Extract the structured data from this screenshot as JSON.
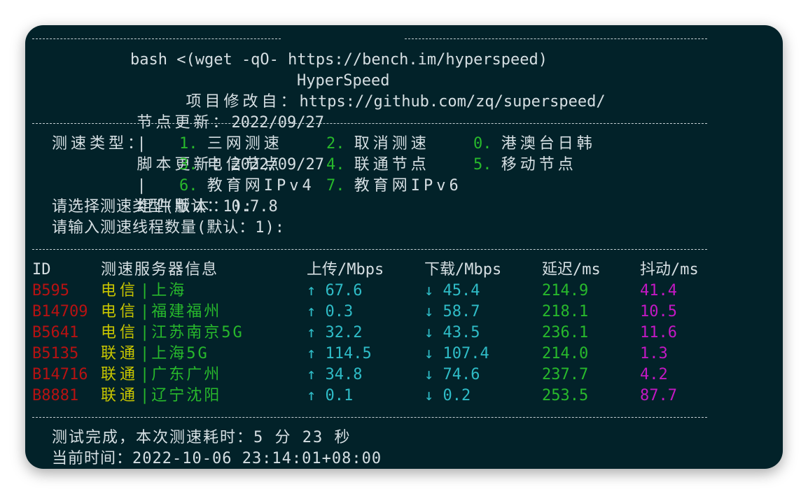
{
  "title_dash_left": "---------------------------",
  "title": "HyperSpeed",
  "title_dash_right": "--------------------------------",
  "command": "bash <(wget -qO- https://bench.im/hyperspeed)",
  "source_label": "项目修改自：",
  "source_url": "https://github.com/zq/superspeed/",
  "node_update_label": "节点更新：",
  "node_update_date": "2022/09/27",
  "sep": "|",
  "script_update_label": "脚本更新：",
  "script_update_date": "2022/09/27",
  "component_label": "组件版本：",
  "component_version": "0.7.8",
  "menu": {
    "type_label": "测速类型：",
    "options": [
      {
        "num": "1.",
        "label": "三网测速"
      },
      {
        "num": "2.",
        "label": "取消测速"
      },
      {
        "num": "0.",
        "label": "港澳台日韩"
      },
      {
        "num": "3.",
        "label": "电信节点"
      },
      {
        "num": "4.",
        "label": "联通节点"
      },
      {
        "num": "5.",
        "label": "移动节点"
      },
      {
        "num": "6.",
        "label": "教育网IPv4"
      },
      {
        "num": "7.",
        "label": "教育网IPv6"
      }
    ],
    "prompt_type": "请选择测速类型(默认：1):",
    "prompt_threads": "请输入测速线程数量(默认：1):"
  },
  "table": {
    "headers": [
      "ID",
      "测速服务器信息",
      "上传/Mbps",
      "下载/Mbps",
      "延迟/ms",
      "抖动/ms"
    ],
    "rows": [
      {
        "id": "B595",
        "isp": "电信",
        "loc": "|上海",
        "up": "↑ 67.6",
        "down": "↓ 45.4",
        "latency": "214.9",
        "jitter": "41.4"
      },
      {
        "id": "B14709",
        "isp": "电信",
        "loc": "|福建福州",
        "up": "↑ 0.3",
        "down": "↓ 58.7",
        "latency": "218.1",
        "jitter": "10.5"
      },
      {
        "id": "B5641",
        "isp": "电信",
        "loc": "|江苏南京5G",
        "up": "↑ 32.2",
        "down": "↓ 43.5",
        "latency": "236.1",
        "jitter": "11.6"
      },
      {
        "id": "B5135",
        "isp": "联通",
        "loc": "|上海5G",
        "up": "↑ 114.5",
        "down": "↓ 107.4",
        "latency": "214.0",
        "jitter": "1.3"
      },
      {
        "id": "B14716",
        "isp": "联通",
        "loc": "|广东广州",
        "up": "↑ 34.8",
        "down": "↓ 74.6",
        "latency": "237.7",
        "jitter": "4.2"
      },
      {
        "id": "B8881",
        "isp": "联通",
        "loc": "|辽宁沈阳",
        "up": "↑ 0.1",
        "down": "↓ 0.2",
        "latency": "253.5",
        "jitter": "87.7"
      }
    ]
  },
  "finish": "测试完成，本次测速耗时：5 分 23 秒",
  "current_time": "当前时间：2022-10-06 23:14:01+08:00",
  "colors": {
    "background": "#022229",
    "text": "#d6dfe3",
    "green": "#28b92c",
    "red": "#b81212",
    "yellow": "#c9c600",
    "cyan": "#2fbcc7",
    "magenta": "#c418c4"
  }
}
